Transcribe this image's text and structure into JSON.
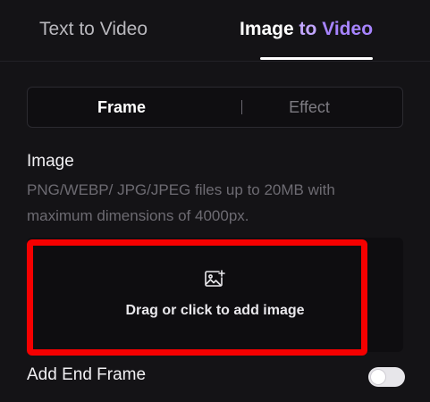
{
  "tabs": {
    "text_to_video": "Text to Video",
    "image_to_video": {
      "word1": "Image",
      "word2": "to",
      "word3": "Video"
    },
    "active": "image_to_video"
  },
  "segment": {
    "frame_label": "Frame",
    "divider": "|",
    "effect_label": "Effect",
    "active": "frame"
  },
  "image_section": {
    "title": "Image",
    "description": "PNG/WEBP/ JPG/JPEG files up to 20MB with maximum dimensions of 4000px."
  },
  "upload": {
    "icon": "image-upload-icon",
    "label": "Drag or click to add image",
    "highlight_color": "#f50000"
  },
  "end_frame": {
    "label": "Add End Frame",
    "enabled": false
  },
  "colors": {
    "background": "#141316",
    "accent_purple": "#a784ff",
    "highlight_red": "#f50000"
  }
}
